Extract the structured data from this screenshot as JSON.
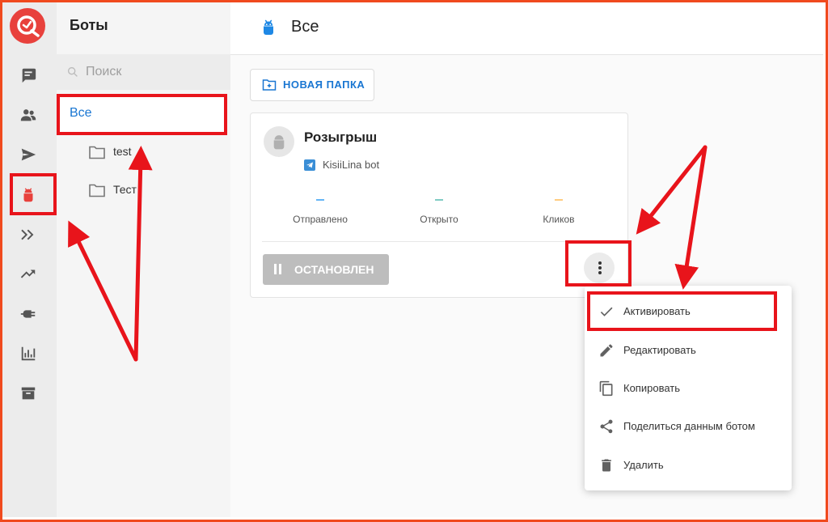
{
  "sidebar": {
    "title": "Боты",
    "search_placeholder": "Поиск",
    "folders": [
      {
        "label": "Все"
      },
      {
        "label": "test"
      },
      {
        "label": "Тест"
      }
    ]
  },
  "rail": {
    "icons": [
      "chat-icon",
      "users-icon",
      "send-icon",
      "bot-icon",
      "forward-icon",
      "trending-icon",
      "plug-icon",
      "bar-chart-icon",
      "archive-icon"
    ]
  },
  "main": {
    "title": "Все",
    "new_folder_label": "НОВАЯ ПАПКА",
    "card": {
      "name": "Розыгрыш",
      "bot_name": "KisiiLina bot",
      "stats": [
        {
          "label": "Отправлено",
          "color": "#64b5f6"
        },
        {
          "label": "Открыто",
          "color": "#80cbc4"
        },
        {
          "label": "Кликов",
          "color": "#ffcc80"
        }
      ],
      "status_label": "ОСТАНОВЛЕН"
    }
  },
  "menu": {
    "items": [
      {
        "label": "Активировать",
        "icon": "check-icon"
      },
      {
        "label": "Редактировать",
        "icon": "pencil-icon"
      },
      {
        "label": "Копировать",
        "icon": "copy-icon"
      },
      {
        "label": "Поделиться данным ботом",
        "icon": "share-icon"
      },
      {
        "label": "Удалить",
        "icon": "trash-icon"
      }
    ]
  },
  "colors": {
    "accent": "#1976d2",
    "brand": "#e8413c",
    "highlight": "#e8141b",
    "frame": "#f04a1e"
  }
}
